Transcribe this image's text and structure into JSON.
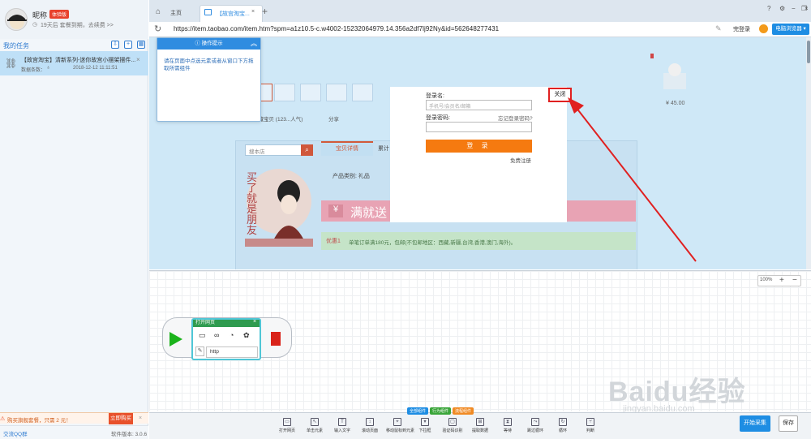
{
  "profile": {
    "name": "昵称",
    "badge": "体验版",
    "subtitle": "19天后 套餐到期，去续费 >>"
  },
  "sidebar": {
    "tasks_title": "我的任务",
    "task": {
      "title": "【故宫淘宝】清新系列-迷你故宫小摆架摆件...",
      "meta": "数据条数：",
      "date": "2018-12-12 11:11:51"
    }
  },
  "promo": {
    "text": "购买旗舰套餐，只需 2 元！",
    "cta": "立即购买",
    "close": "×"
  },
  "footer": {
    "qq": "交流QQ群",
    "version": "软件版本: 3.0.6"
  },
  "tabs": {
    "home": "主页",
    "current": "【故宫淘宝...",
    "close": "×",
    "plus": "+"
  },
  "address": {
    "url": "https://item.taobao.com/item.htm?spm=a1z10.5-c.w4002-15232064979.14.356a2df7lj92Ny&id=562648277431",
    "login": "完登录",
    "browser": "电脑浏览器"
  },
  "page": {
    "shop_search_placeholder": "搜本店",
    "detail_tab": "宝贝详情",
    "detail_tab2": "累计",
    "category": "产品类别: 礼品",
    "banner": "满就送",
    "notice_label": "优惠1",
    "notice_text": "单笔订单满180元，包邮(不包邮地区：西藏,新疆,台湾,香港,澳门,海外)。",
    "fav": "收藏宝贝 (123...人气)",
    "share": "分享",
    "price": "¥ 45.00",
    "woman_text": "买了就是朋友",
    "yen": "¥"
  },
  "tip": {
    "title": "操作提示",
    "body": "请在页面中点选元素或者从窗口下方拖取所需组件"
  },
  "login": {
    "user_label": "登录名:",
    "user_placeholder": "手机号/会员名/邮箱",
    "pass_label": "登录密码:",
    "forgot": "忘记登录密码?",
    "submit": "登 录",
    "register": "免费注册"
  },
  "close_button": "关闭",
  "zoom": {
    "level": "100%",
    "plus": "+",
    "minus": "−"
  },
  "node": {
    "title": "打开网页",
    "url_hint": "http"
  },
  "watermark": {
    "main": "Baidu经验",
    "sub": "jingyan.baidu.com"
  },
  "toolbar": {
    "groups": [
      "全部组件",
      "行为组件",
      "流程组件"
    ],
    "tools": [
      "打开网页",
      "单击元素",
      "输入文字",
      "滚动页面",
      "移动鼠标到元素",
      "下拉框",
      "验证码识别",
      "提取数据",
      "等待",
      "跳过循环",
      "循环",
      "判断"
    ],
    "start": "开始采集",
    "save": "保存"
  }
}
